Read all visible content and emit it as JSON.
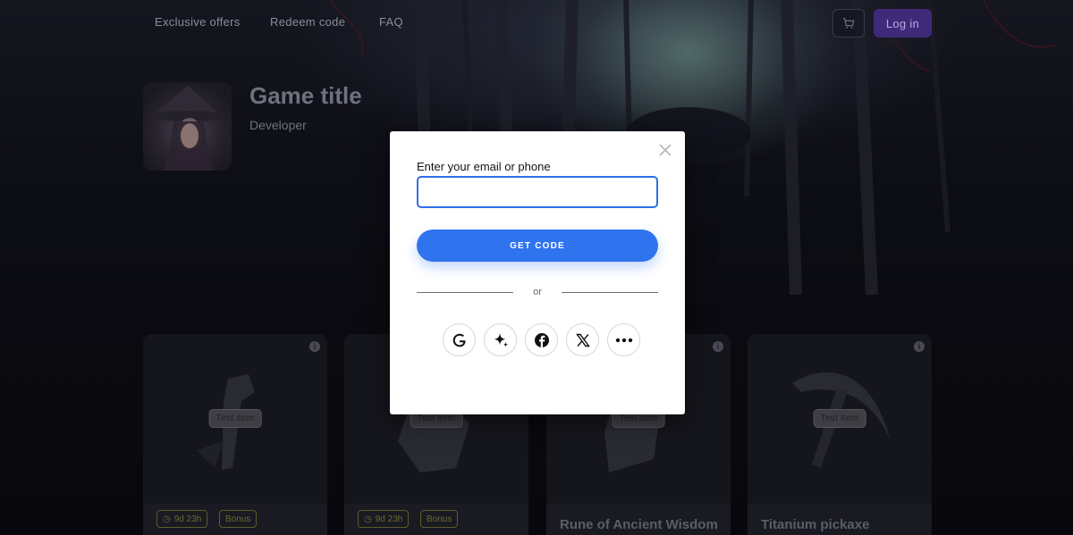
{
  "nav": {
    "links": [
      "Exclusive offers",
      "Redeem code",
      "FAQ"
    ],
    "cart_icon": "cart-icon",
    "login_label": "Log in"
  },
  "game": {
    "title": "Game title",
    "developer": "Developer"
  },
  "cards": [
    {
      "tag": "Test item",
      "timer": "9d 23h",
      "badge": "Bonus",
      "name": ""
    },
    {
      "tag": "Test item",
      "timer": "9d 23h",
      "badge": "Bonus",
      "name": ""
    },
    {
      "tag": "Test item",
      "timer": "",
      "badge": "",
      "name": "Rune of Ancient Wisdom"
    },
    {
      "tag": "Test item",
      "timer": "",
      "badge": "",
      "name": "Titanium pickaxe"
    }
  ],
  "modal": {
    "field_label": "Enter your email or phone",
    "input_value": "",
    "button_label": "GET CODE",
    "divider_text": "or",
    "social_icons": [
      "google-icon",
      "sparkle-icon",
      "facebook-icon",
      "x-icon",
      "more-icon"
    ]
  },
  "colors": {
    "primary": "#3073ef",
    "login_bg": "#3f2a7a",
    "chip": "#5b5a2a"
  }
}
